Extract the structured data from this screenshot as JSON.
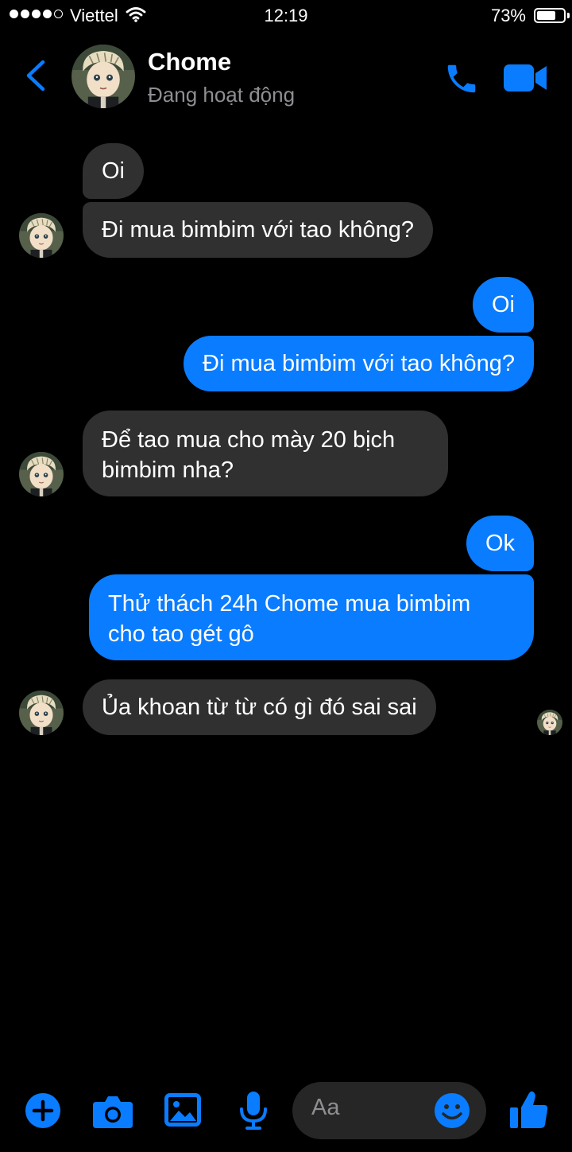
{
  "status_bar": {
    "carrier": "Viettel",
    "time": "12:19",
    "battery_percent": "73%",
    "battery_level": 0.73,
    "signal_bars": 4
  },
  "header": {
    "contact_name": "Chome",
    "status": "Đang hoạt động",
    "back_icon": "chevron-left-icon",
    "call_icon": "phone-icon",
    "video_icon": "video-camera-icon"
  },
  "messages": [
    {
      "from": "contact",
      "text": "Oi"
    },
    {
      "from": "contact",
      "text": "Đi mua bimbim với tao không?"
    },
    {
      "from": "me",
      "text": "Oi"
    },
    {
      "from": "me",
      "text": "Đi mua bimbim với tao không?"
    },
    {
      "from": "contact",
      "lines": [
        "Để tao mua cho mày 20 bịch",
        "bimbim nha?"
      ]
    },
    {
      "from": "me",
      "text": "Ok"
    },
    {
      "from": "me",
      "lines": [
        "Thử thách 24h Chome mua bimbim",
        "cho tao gét gô"
      ]
    },
    {
      "from": "contact",
      "text": "Ủa khoan từ từ có gì đó sai sai"
    }
  ],
  "composer": {
    "placeholder": "Aa",
    "icons": [
      "plus-icon",
      "camera-icon",
      "image-icon",
      "microphone-icon",
      "emoji-icon",
      "thumbs-up-icon"
    ]
  },
  "colors": {
    "accent": "#0a7cff",
    "incoming_bubble": "#303030",
    "background": "#000000",
    "secondary_text": "#8e8e93"
  }
}
